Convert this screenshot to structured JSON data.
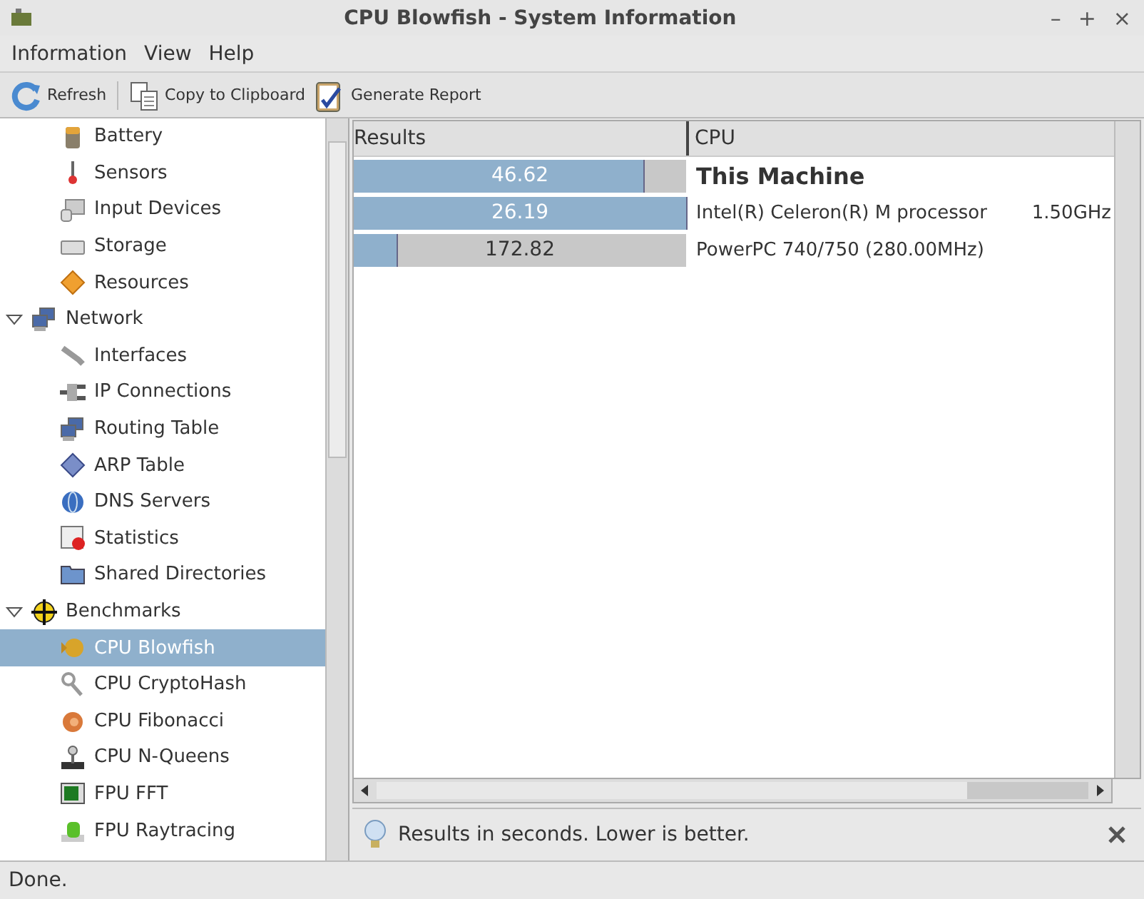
{
  "window": {
    "title": "CPU Blowfish - System Information",
    "controls": [
      "–",
      "+",
      "×"
    ]
  },
  "menu": [
    "Information",
    "View",
    "Help"
  ],
  "toolbar": [
    {
      "label": "Refresh"
    },
    {
      "label": "Copy to Clipboard"
    },
    {
      "label": "Generate Report"
    }
  ],
  "tree": {
    "items_above": [
      {
        "label": "Battery",
        "selected": false
      },
      {
        "label": "Sensors",
        "selected": false
      },
      {
        "label": "Input Devices",
        "selected": false
      },
      {
        "label": "Storage",
        "selected": false
      },
      {
        "label": "Resources",
        "selected": false
      }
    ],
    "groups": [
      {
        "label": "Network",
        "expanded": true,
        "children": [
          {
            "label": "Interfaces",
            "selected": false
          },
          {
            "label": "IP Connections",
            "selected": false
          },
          {
            "label": "Routing Table",
            "selected": false
          },
          {
            "label": "ARP Table",
            "selected": false
          },
          {
            "label": "DNS Servers",
            "selected": false
          },
          {
            "label": "Statistics",
            "selected": false
          },
          {
            "label": "Shared Directories",
            "selected": false
          }
        ]
      },
      {
        "label": "Benchmarks",
        "expanded": true,
        "children": [
          {
            "label": "CPU Blowfish",
            "selected": true
          },
          {
            "label": "CPU CryptoHash",
            "selected": false
          },
          {
            "label": "CPU Fibonacci",
            "selected": false
          },
          {
            "label": "CPU N-Queens",
            "selected": false
          },
          {
            "label": "FPU FFT",
            "selected": false
          },
          {
            "label": "FPU Raytracing",
            "selected": false
          }
        ]
      }
    ]
  },
  "table": {
    "columns": [
      "Results",
      "CPU"
    ],
    "rows": [
      {
        "result": "46.62",
        "level": 0.87,
        "cpu": "This Machine",
        "current": true
      },
      {
        "result": "26.19",
        "level": 1.0,
        "cpu": "Intel(R) Celeron(R) M processor",
        "clock": "1.50GHz",
        "current": false
      },
      {
        "result": "172.82",
        "level": 0.13,
        "cpu": "PowerPC 740/750 (280.00MHz)",
        "current": false
      }
    ]
  },
  "info_bar": {
    "message": "Results in seconds. Lower is better."
  },
  "status_bar": "Done."
}
